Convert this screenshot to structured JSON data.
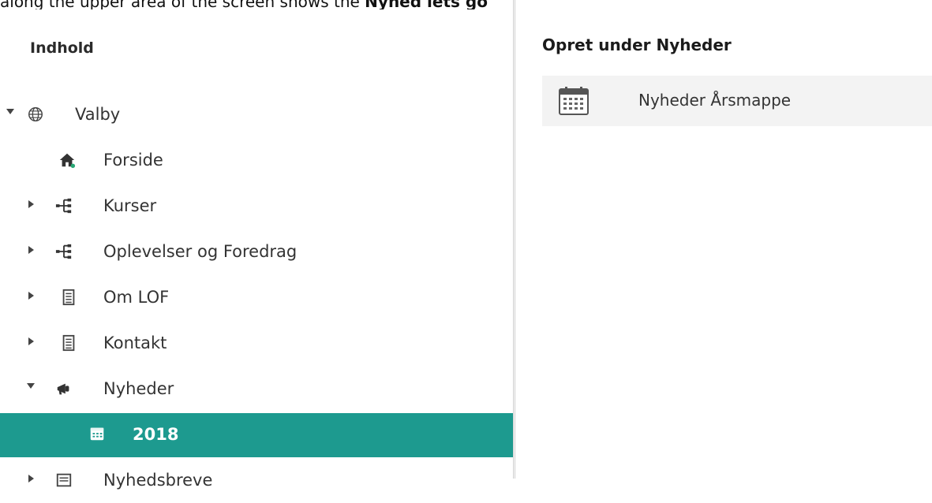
{
  "top_fragment": {
    "text_plain": "along the upper area of the screen shows the ",
    "text_bold": "Nyhed lets go"
  },
  "tree": {
    "heading": "Indhold",
    "items": [
      {
        "label": "Valby",
        "icon": "globe-icon",
        "expanded": true
      },
      {
        "label": "Forside",
        "icon": "home-icon"
      },
      {
        "label": "Kurser",
        "icon": "sitemap-icon",
        "expanded": false
      },
      {
        "label": "Oplevelser og Foredrag",
        "icon": "sitemap-icon",
        "expanded": false
      },
      {
        "label": "Om LOF",
        "icon": "document-icon",
        "expanded": false
      },
      {
        "label": "Kontakt",
        "icon": "document-icon",
        "expanded": false
      },
      {
        "label": "Nyheder",
        "icon": "megaphone-icon",
        "expanded": true
      },
      {
        "label": "2018",
        "icon": "calendar-icon",
        "selected": true
      },
      {
        "label": "Nyhedsbreve",
        "icon": "newsletter-icon",
        "expanded": false
      }
    ]
  },
  "create_panel": {
    "title": "Opret under Nyheder",
    "items": [
      {
        "label": "Nyheder Årsmappe",
        "icon": "calendar-icon"
      }
    ]
  },
  "colors": {
    "selected_bg": "#1d9a8f",
    "selected_text": "#ffffff",
    "item_bg": "#f3f3f3"
  }
}
